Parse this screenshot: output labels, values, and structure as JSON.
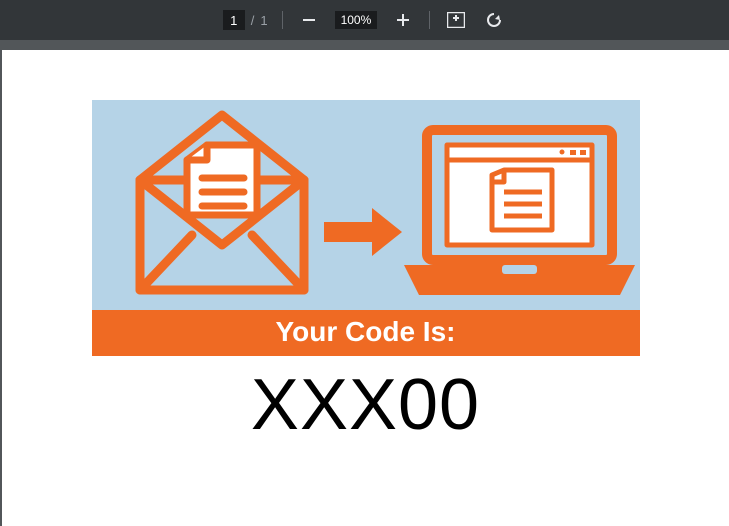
{
  "toolbar": {
    "current_page": "1",
    "page_separator": "/",
    "total_pages": "1",
    "zoom_level": "100%"
  },
  "banner": {
    "label": "Your Code Is:"
  },
  "code_value": "XXX00",
  "icons": {
    "zoom_out": "zoom-out-icon",
    "zoom_in": "zoom-in-icon",
    "fit": "fit-page-icon",
    "rotate": "rotate-icon",
    "envelope": "envelope-document-icon",
    "arrow": "arrow-right-icon",
    "laptop": "laptop-document-icon"
  }
}
